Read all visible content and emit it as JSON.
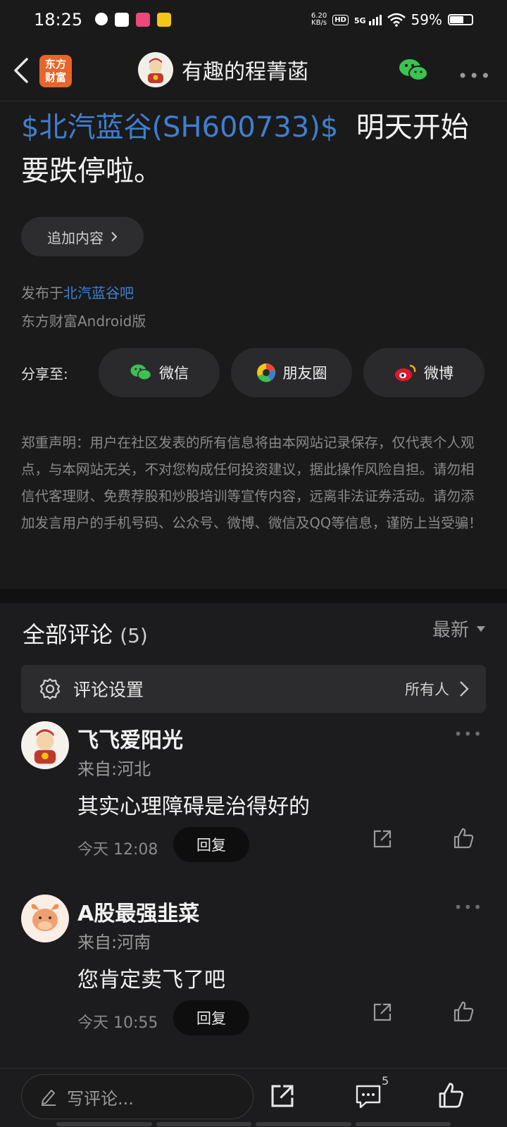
{
  "status_bar": {
    "time": "18:25",
    "net_speed_value": "6.20",
    "net_speed_unit": "KB/s",
    "hd": "HD",
    "network": "5G",
    "battery": "59%"
  },
  "header": {
    "logo_line1": "东方",
    "logo_line2": "财富",
    "author_name": "有趣的程菁菡",
    "more_icon": "ellipsis-icon"
  },
  "post": {
    "stock_tag": "$北汽蓝谷(SH600733)$",
    "text": "明天开始要跌停啦。",
    "add_content_label": "追加内容",
    "published_prefix": "发布于",
    "forum_name": "北汽蓝谷吧",
    "client": "东方财富Android版",
    "share_label": "分享至:",
    "share_options": [
      "微信",
      "朋友圈",
      "微博"
    ],
    "disclaimer": "郑重声明：用户在社区发表的所有信息将由本网站记录保存，仅代表个人观点，与本网站无关，不对您构成任何投资建议，据此操作风险自担。请勿相信代客理财、免费荐股和炒股培训等宣传内容，远离非法证券活动。请勿添加发言用户的手机号码、公众号、微博、微信及QQ等信息，谨防上当受骗！"
  },
  "comments": {
    "title": "全部评论",
    "count": "(5)",
    "sort_label": "最新",
    "settings_label": "评论设置",
    "settings_value": "所有人",
    "items": [
      {
        "name": "飞飞爱阳光",
        "location": "来自:河北",
        "text": "其实心理障碍是治得好的",
        "time": "今天 12:08",
        "reply_label": "回复"
      },
      {
        "name": "A股最强韭菜",
        "location": "来自:河南",
        "text": "您肯定卖飞了吧",
        "time": "今天 10:55",
        "reply_label": "回复"
      }
    ]
  },
  "bottom_bar": {
    "write_placeholder": "写评论...",
    "comment_count": "5"
  },
  "colors": {
    "background": "#1a1a1b",
    "link_blue": "#3f7fd0",
    "brand_orange": "#e8652a",
    "wechat_green": "#3cc251"
  }
}
